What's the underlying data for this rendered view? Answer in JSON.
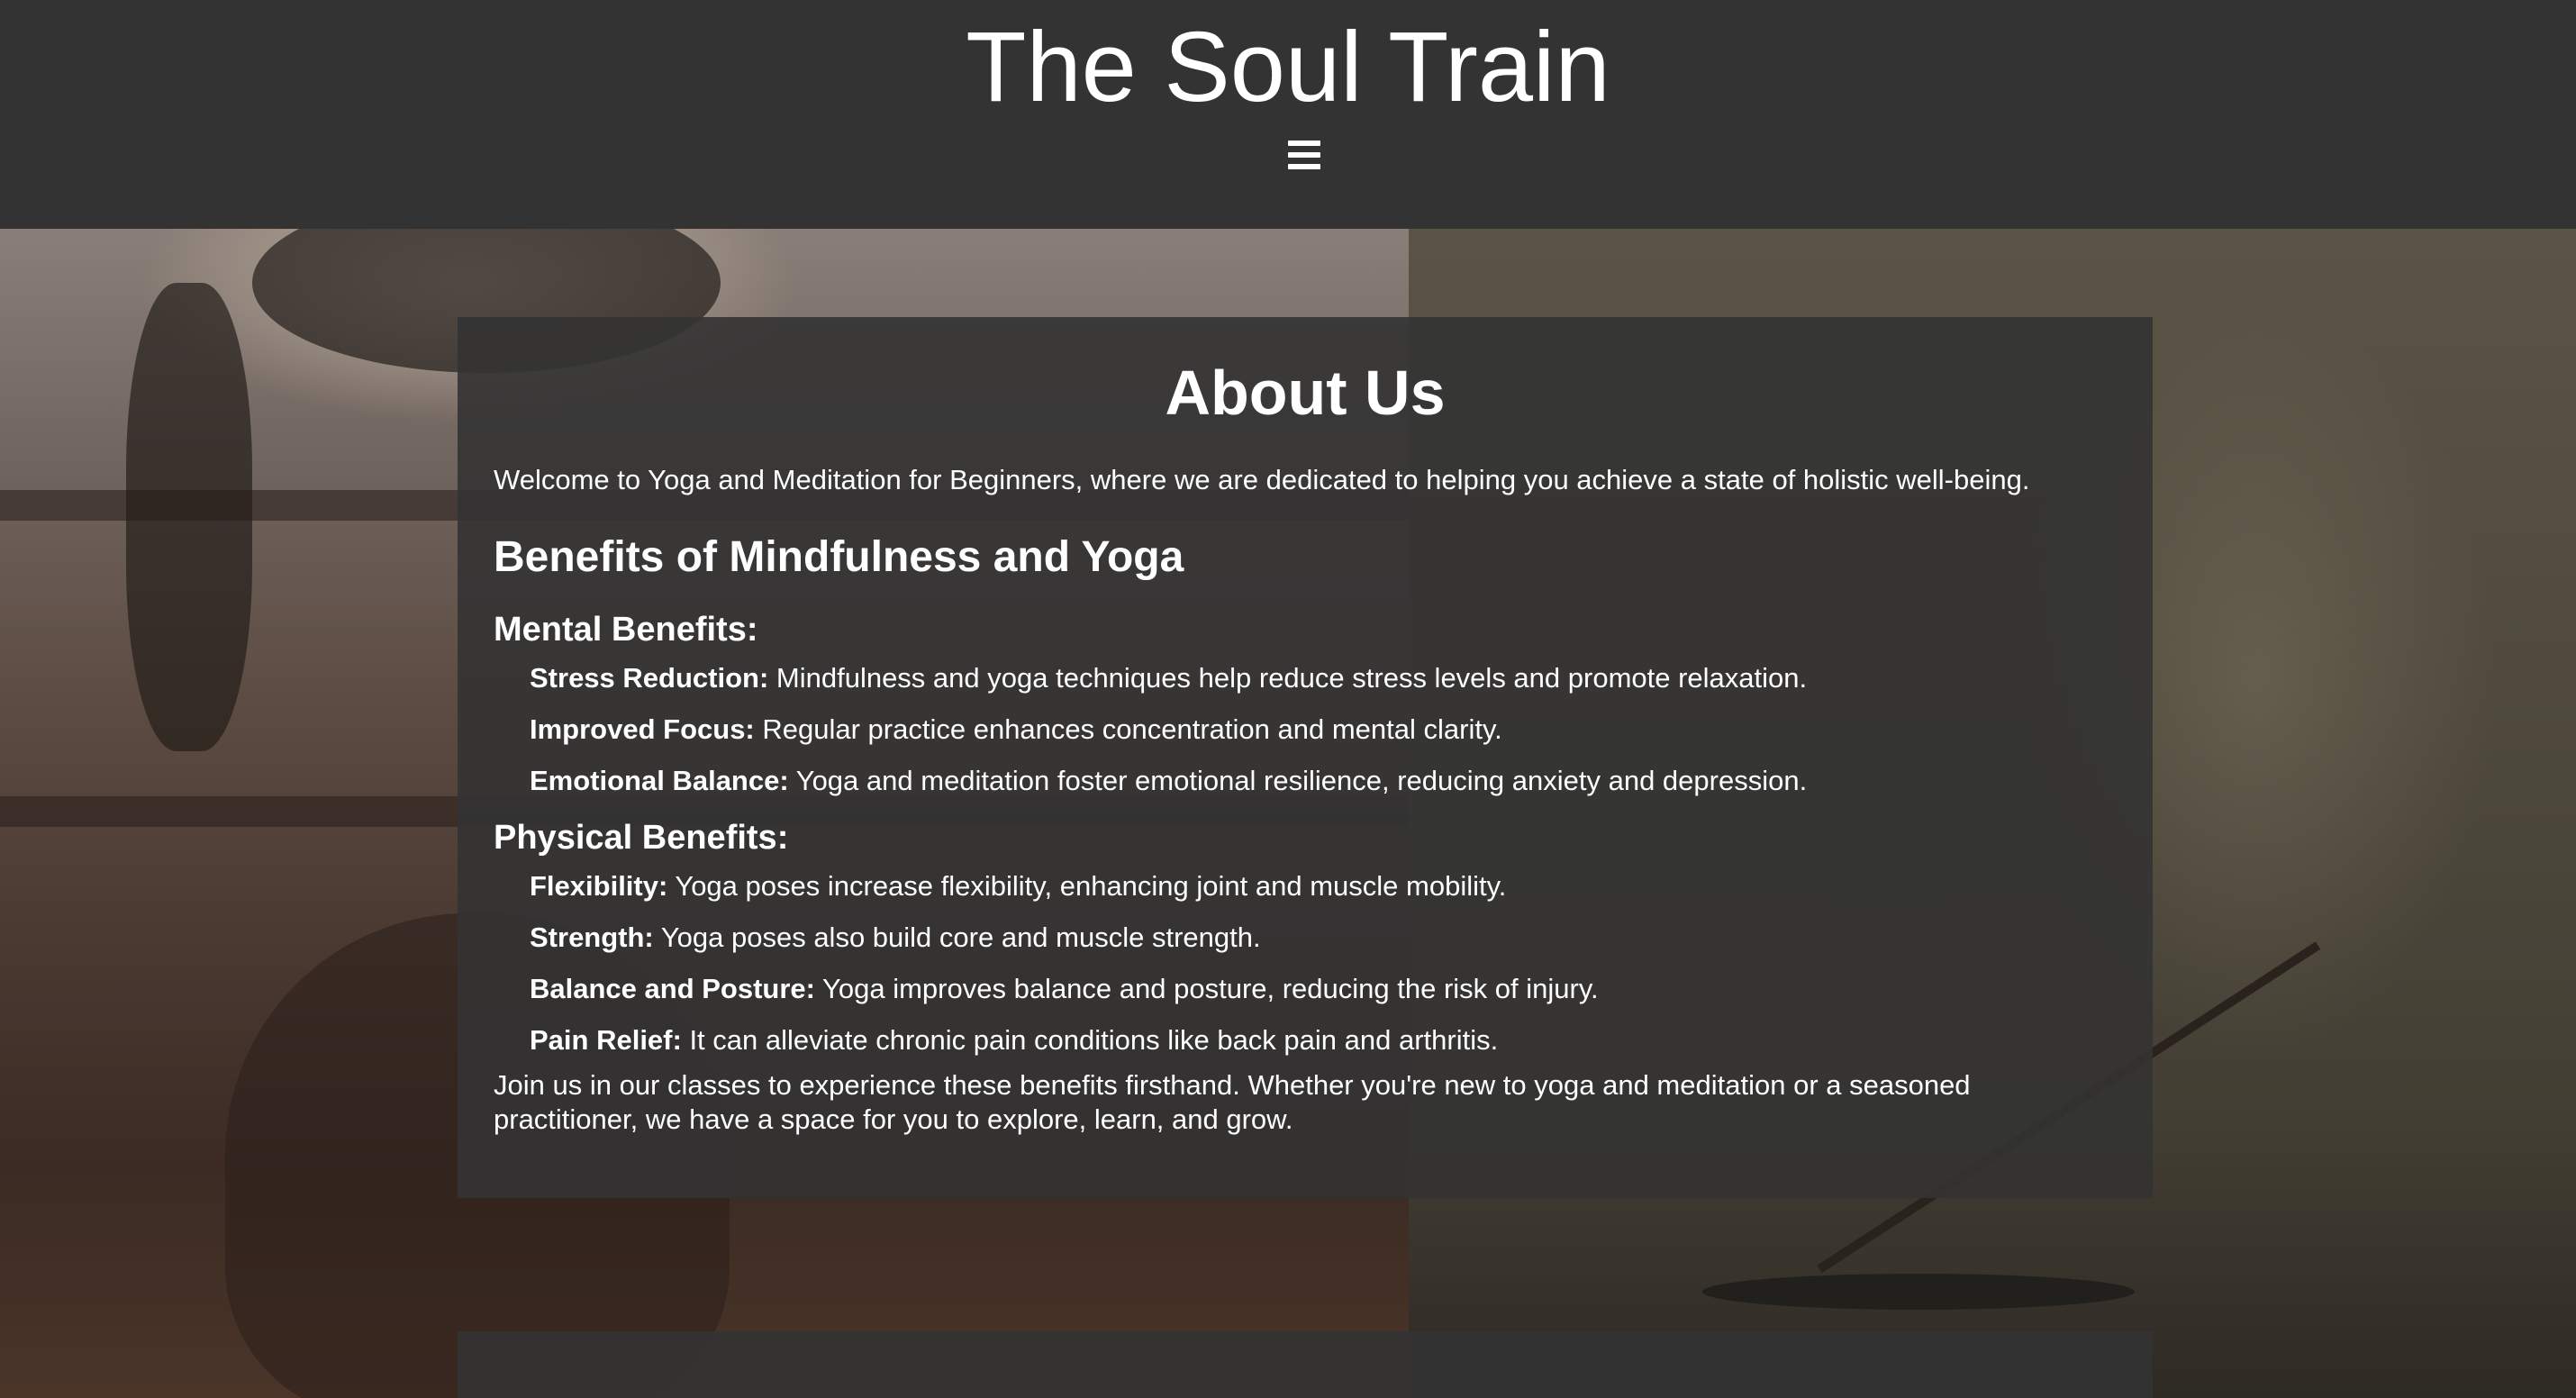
{
  "header": {
    "title": "The Soul Train",
    "menu_icon": "hamburger-menu-icon"
  },
  "about": {
    "title": "About Us",
    "intro": "Welcome to Yoga and Meditation for Beginners, where we are dedicated to helping you achieve a state of holistic well-being.",
    "benefits_title": "Benefits of Mindfulness and Yoga",
    "mental": {
      "title": "Mental Benefits:",
      "items": [
        {
          "label": "Stress Reduction:",
          "text": " Mindfulness and yoga techniques help reduce stress levels and promote relaxation."
        },
        {
          "label": "Improved Focus:",
          "text": " Regular practice enhances concentration and mental clarity."
        },
        {
          "label": "Emotional Balance:",
          "text": " Yoga and meditation foster emotional resilience, reducing anxiety and depression."
        }
      ]
    },
    "physical": {
      "title": "Physical Benefits:",
      "items": [
        {
          "label": "Flexibility:",
          "text": " Yoga poses increase flexibility, enhancing joint and muscle mobility."
        },
        {
          "label": "Strength:",
          "text": " Yoga poses also build core and muscle strength."
        },
        {
          "label": "Balance and Posture:",
          "text": " Yoga improves balance and posture, reducing the risk of injury."
        },
        {
          "label": "Pain Relief:",
          "text": " It can alleviate chronic pain conditions like back pain and arthritis."
        }
      ]
    },
    "closing": "Join us in our classes to experience these benefits firsthand. Whether you're new to yoga and meditation or a seasoned practitioner, we have a space for you to explore, learn, and grow."
  },
  "colors": {
    "header_bg": "#333333",
    "card_bg": "rgba(51,51,51,0.9)",
    "text": "#ffffff"
  }
}
